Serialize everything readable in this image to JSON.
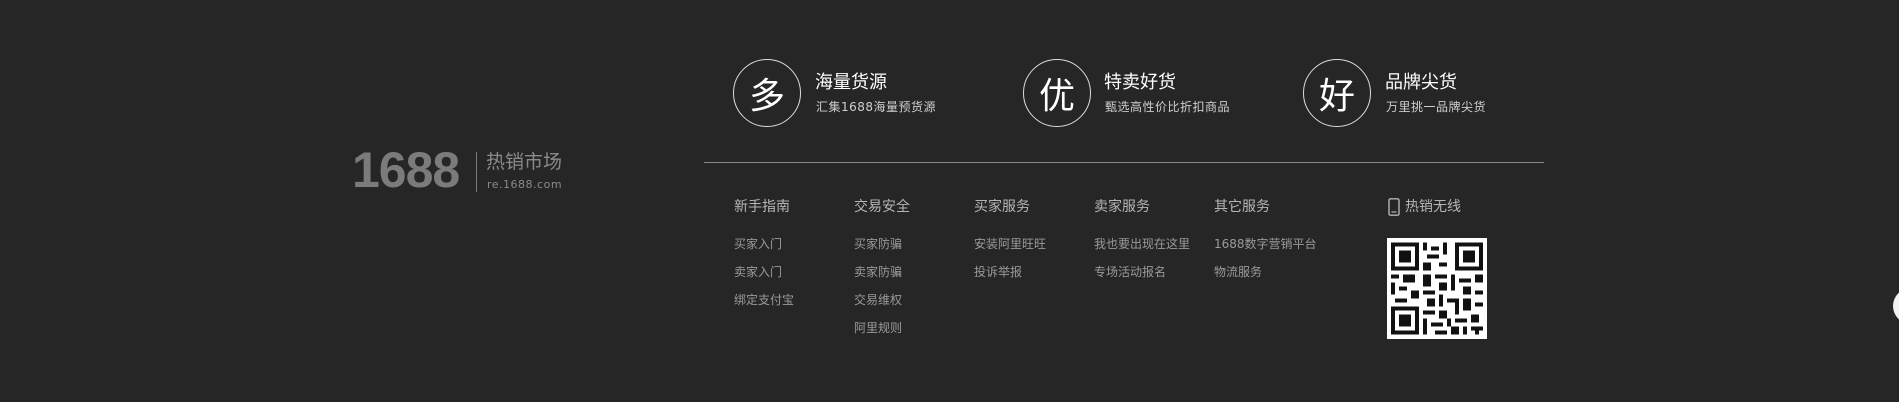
{
  "logo": {
    "number": "1688",
    "title": "热销市场",
    "subtitle": "re.1688.com"
  },
  "features": [
    {
      "glyph": "多",
      "title": "海量货源",
      "desc": "汇集1688海量预货源"
    },
    {
      "glyph": "优",
      "title": "特卖好货",
      "desc": "甄选高性价比折扣商品"
    },
    {
      "glyph": "好",
      "title": "品牌尖货",
      "desc": "万里挑一品牌尖货"
    }
  ],
  "columns": [
    {
      "heading": "新手指南",
      "links": [
        "买家入门",
        "卖家入门",
        "绑定支付宝"
      ]
    },
    {
      "heading": "交易安全",
      "links": [
        "买家防骗",
        "卖家防骗",
        "交易维权",
        "阿里规则"
      ]
    },
    {
      "heading": "买家服务",
      "links": [
        "安装阿里旺旺",
        "投诉举报"
      ]
    },
    {
      "heading": "卖家服务",
      "links": [
        "我也要出现在这里",
        "专场活动报名"
      ]
    },
    {
      "heading": "其它服务",
      "links": [
        "1688数字营销平台",
        "物流服务"
      ]
    }
  ],
  "mobile": {
    "label": "热销无线",
    "icon": "mobile-phone-icon"
  },
  "qr": {
    "icon": "qr-code"
  }
}
